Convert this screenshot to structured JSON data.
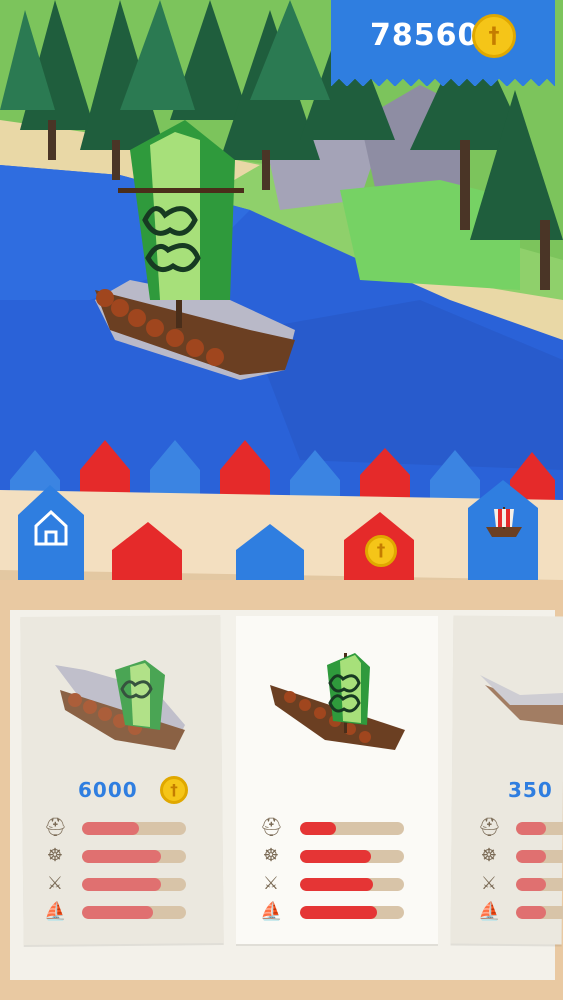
{
  "hud": {
    "coin_count": "785601",
    "coin_icon": "coin-icon"
  },
  "tabs": [
    {
      "name": "home-tab",
      "icon": "home-icon",
      "color": "#2f7ee0"
    },
    {
      "name": "red-tab",
      "icon": "",
      "color": "#e52a2a"
    },
    {
      "name": "blue-tab",
      "icon": "",
      "color": "#2f7ee0"
    },
    {
      "name": "shop-tab",
      "icon": "coin-icon",
      "color": "#e52a2a"
    },
    {
      "name": "ship-tab",
      "icon": "viking-ship-icon",
      "color": "#2f7ee0"
    }
  ],
  "colors": {
    "stat_fill_locked": "#e07070",
    "stat_fill_owned": "#e53535",
    "stat_track": "#d8c4a8",
    "price": "#2f7ee0"
  },
  "cards": [
    {
      "price": "6000",
      "locked": true,
      "stats": [
        {
          "icon": "helmet-icon",
          "level": 0.55
        },
        {
          "icon": "ship-wheel-icon",
          "level": 0.76
        },
        {
          "icon": "crossed-axes-icon",
          "level": 0.76
        },
        {
          "icon": "sail-icon",
          "level": 0.68
        }
      ]
    },
    {
      "price": "",
      "locked": false,
      "stats": [
        {
          "icon": "helmet-icon",
          "level": 0.35
        },
        {
          "icon": "ship-wheel-icon",
          "level": 0.68
        },
        {
          "icon": "crossed-axes-icon",
          "level": 0.7
        },
        {
          "icon": "sail-icon",
          "level": 0.74
        }
      ]
    },
    {
      "price": "350",
      "locked": true,
      "stats": [
        {
          "icon": "helmet-icon",
          "level": 0.5
        },
        {
          "icon": "ship-wheel-icon",
          "level": 0.5
        },
        {
          "icon": "crossed-axes-icon",
          "level": 0.5
        },
        {
          "icon": "sail-icon",
          "level": 0.5
        }
      ]
    }
  ]
}
